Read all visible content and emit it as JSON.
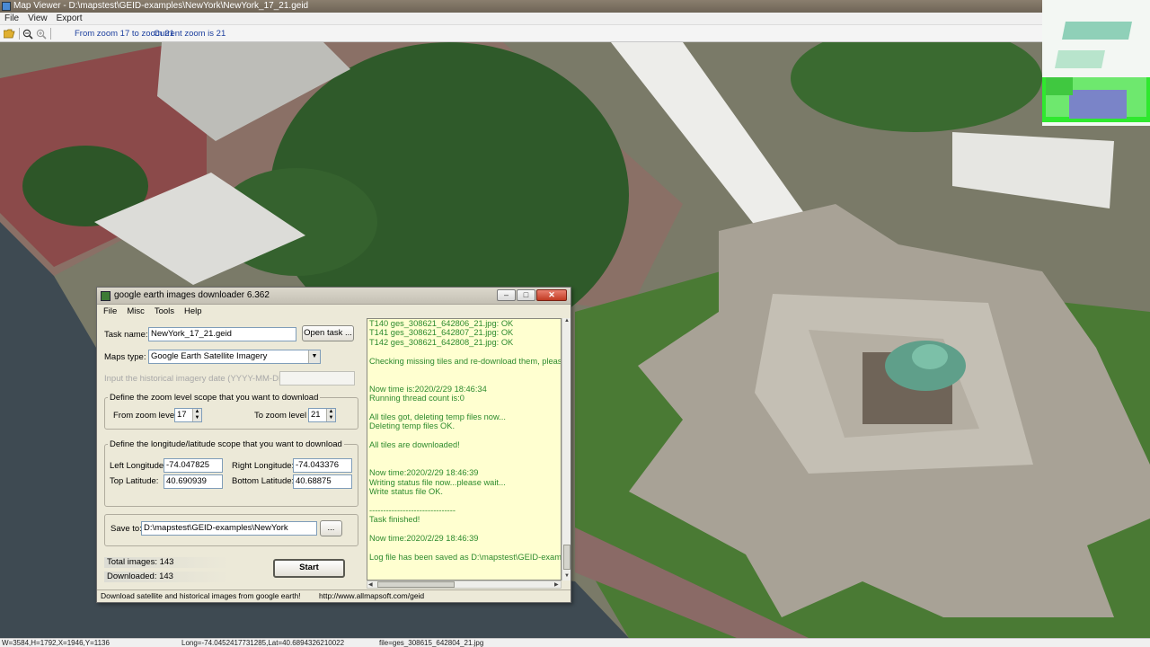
{
  "map_viewer": {
    "title": "Map Viewer - D:\\mapstest\\GEID-examples\\NewYork\\NewYork_17_21.geid",
    "menu": [
      "File",
      "View",
      "Export"
    ],
    "toolbar": {
      "zoom_range": "From zoom 17 to zoom 21",
      "current_zoom": "Current zoom is 21"
    },
    "window_buttons": [
      "–",
      "□",
      "✕"
    ],
    "status": {
      "dims": "W=3584,H=1792,X=1946,Y=1136",
      "coords": "Long=-74.0452417731285,Lat=40.6894326210022",
      "file": "file=ges_308615_642804_21.jpg"
    }
  },
  "dialog": {
    "title": "google earth images downloader 6.362",
    "menu": [
      "File",
      "Misc",
      "Tools",
      "Help"
    ],
    "window_buttons": [
      "–",
      "□",
      "✕"
    ],
    "task_name_label": "Task name:",
    "task_name_value": "NewYork_17_21.geid",
    "open_task_label": "Open task ...",
    "maps_type_label": "Maps type:",
    "maps_type_value": "Google Earth Satellite Imagery",
    "historical_label": "Input the  historical imagery date (YYYY-MM-DD):",
    "zoom_group": {
      "legend": "Define the zoom level scope that you want to download",
      "from_label": "From zoom level",
      "from_value": "17",
      "to_label": "To zoom level",
      "to_value": "21"
    },
    "lonlat_group": {
      "legend": "Define the longitude/latitude scope that you want to download",
      "left_lon_label": "Left Longitude:",
      "left_lon_value": "-74.047825",
      "right_lon_label": "Right Longitude:",
      "right_lon_value": "-74.043376",
      "top_lat_label": "Top Latitude:",
      "top_lat_value": "40.690939",
      "bottom_lat_label": "Bottom Latitude:",
      "bottom_lat_value": "40.68875"
    },
    "save_to_label": "Save to:",
    "save_to_value": "D:\\mapstest\\GEID-examples\\NewYork",
    "browse_label": "...",
    "total_images": "Total images: 143",
    "downloaded": "Downloaded: 143",
    "start_label": "Start",
    "log": [
      "T140 ges_308621_642806_21.jpg:  OK",
      "T141 ges_308621_642807_21.jpg:  OK",
      "T142 ges_308621_642808_21.jpg:  OK",
      "",
      "Checking missing tiles and re-download them, please w",
      "",
      "",
      "Now time is:2020/2/29 18:46:34",
      "Running thread count is:0",
      "",
      "All tiles got, deleting temp files now...",
      "Deleting temp files OK.",
      "",
      "All tiles are downloaded!",
      "",
      "",
      "Now time:2020/2/29 18:46:39",
      "Writing status file now...please wait...",
      "Write status file OK.",
      "",
      "-------------------------------",
      "Task finished!",
      "",
      "Now time:2020/2/29 18:46:39",
      "",
      "Log file has been saved as D:\\mapstest\\GEID-example"
    ],
    "status_left": "Download satellite and historical  images from google earth!",
    "status_url": "http://www.allmapsoft.com/geid"
  }
}
